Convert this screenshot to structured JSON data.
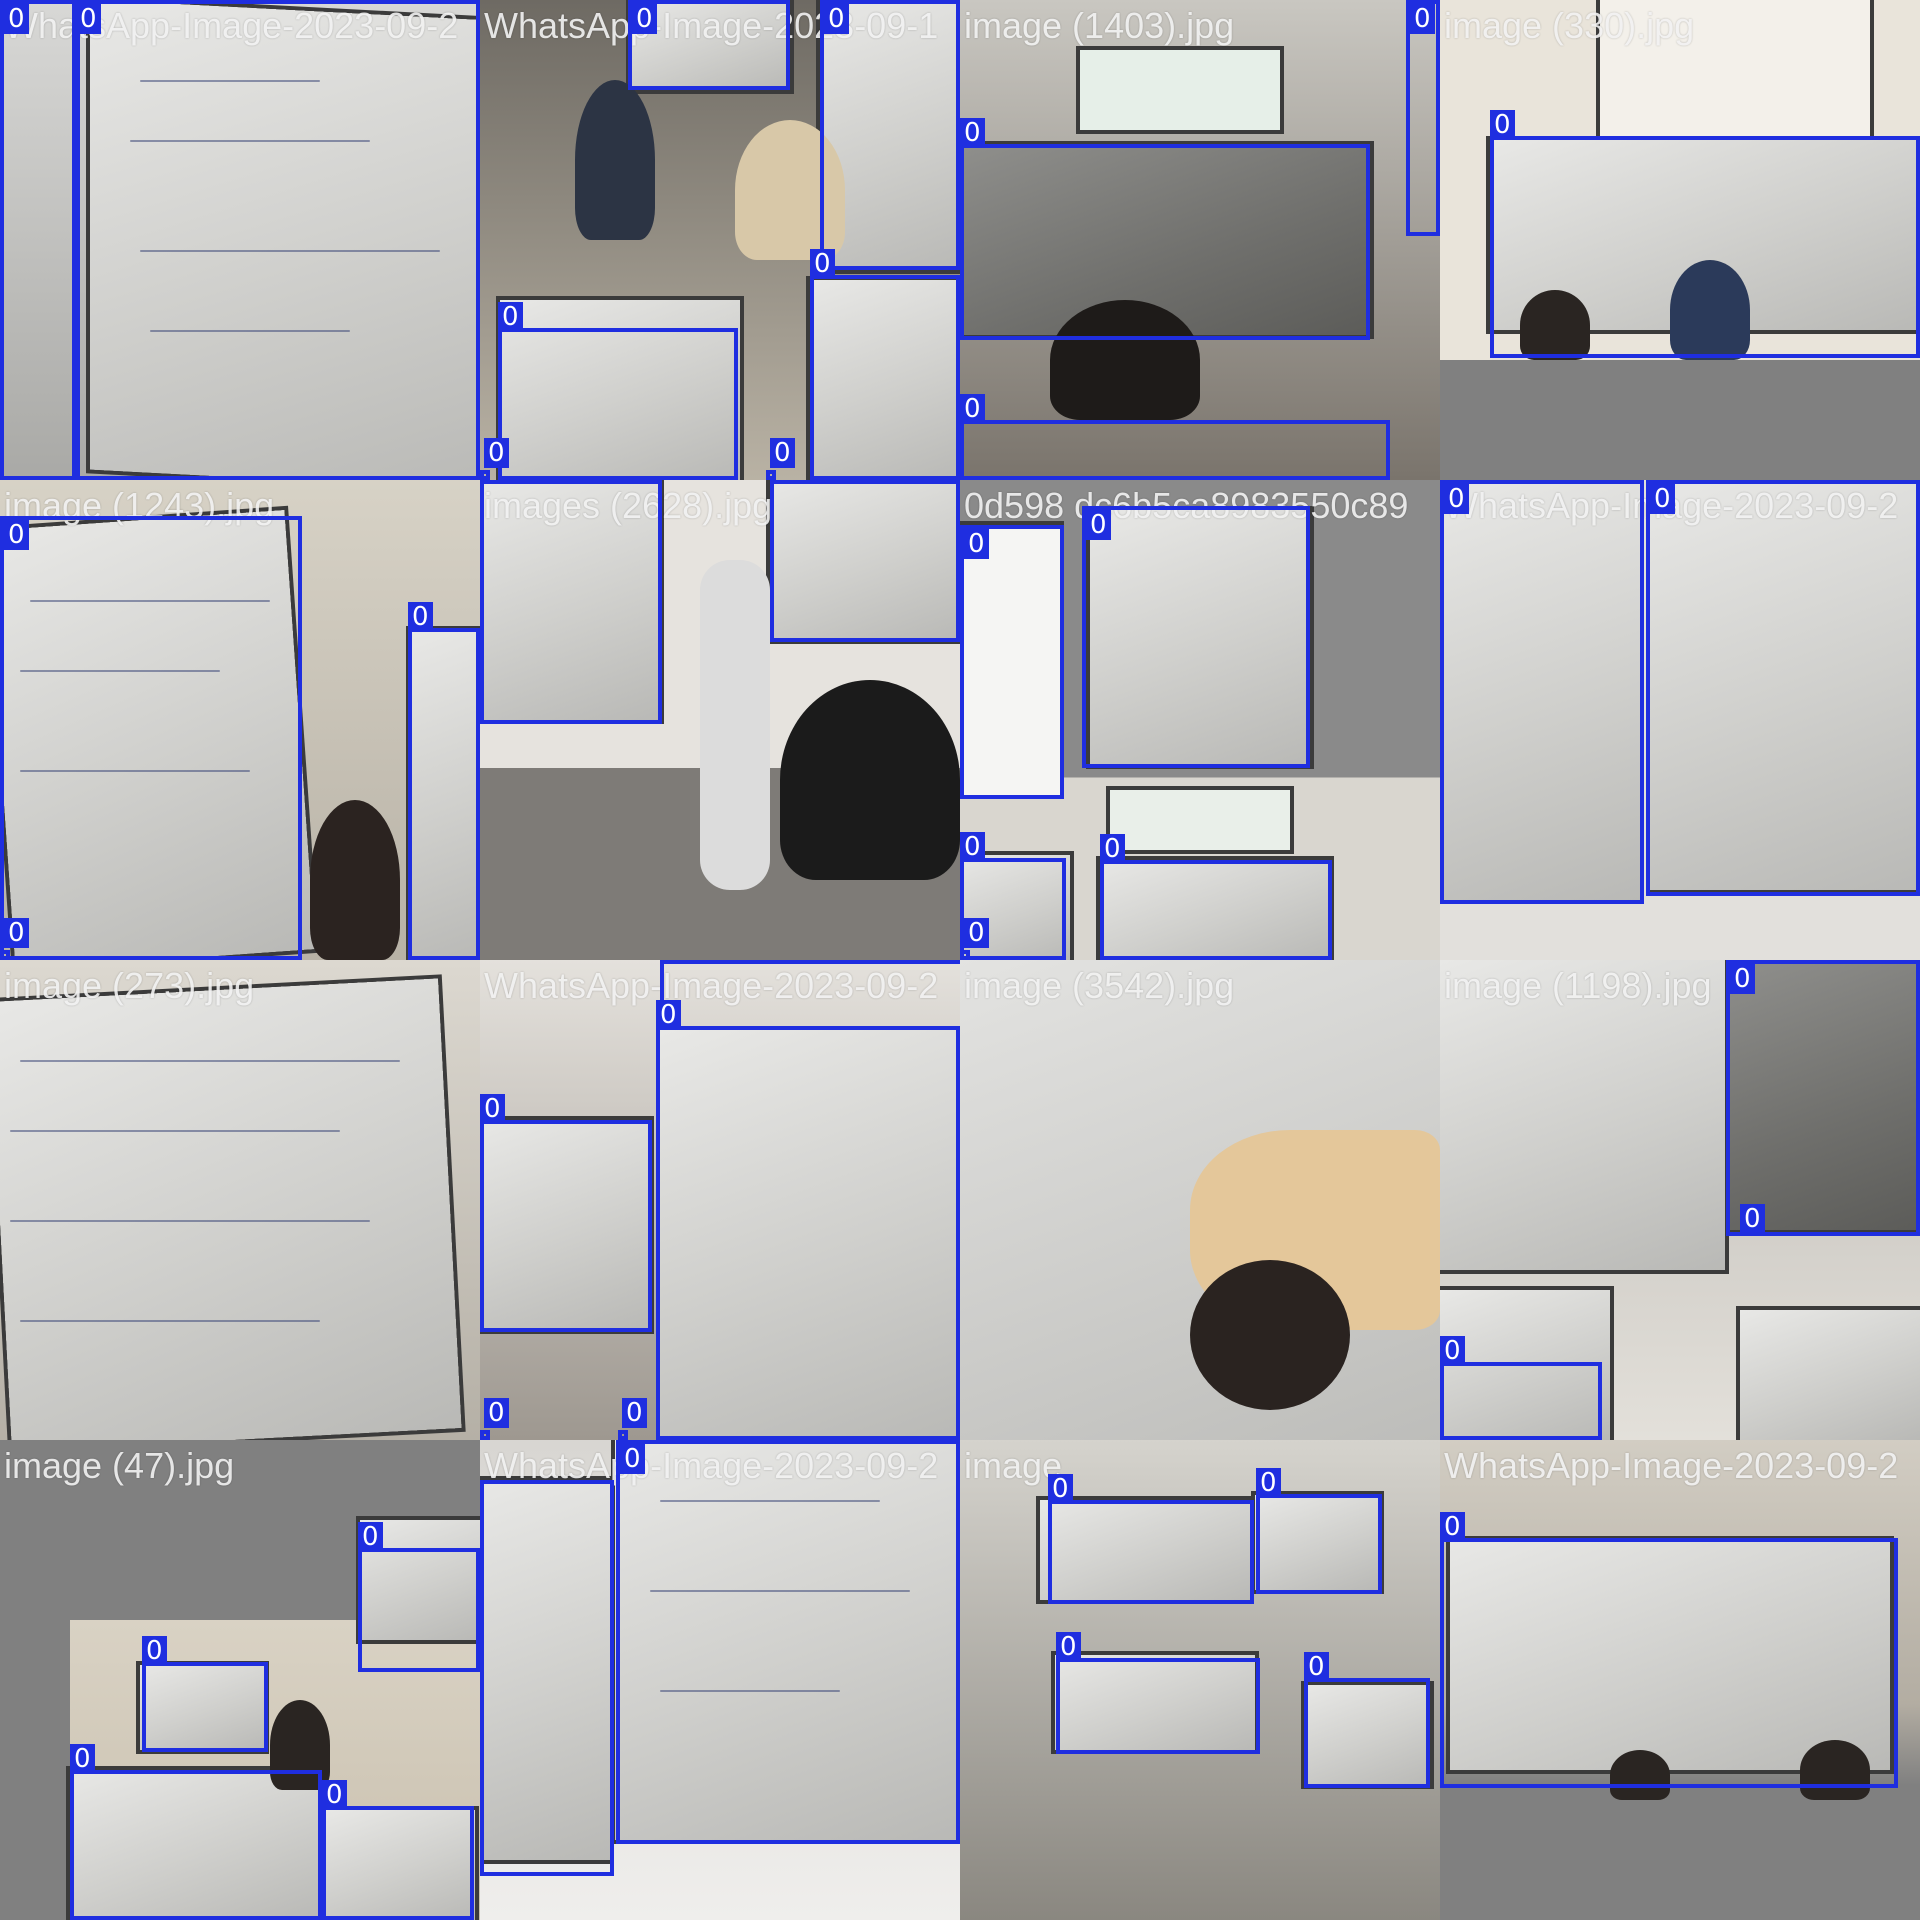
{
  "box_color": "#1f2ee0",
  "tiles": [
    {
      "caption": "WhatsApp-Image-2023-09-2",
      "boxes": [
        "0",
        "0"
      ]
    },
    {
      "caption": "WhatsApp-Image-2023-09-1",
      "boxes": [
        "0",
        "0",
        "0",
        "0",
        "0",
        "0"
      ]
    },
    {
      "caption": "image (1403).jpg",
      "boxes": [
        "0",
        "0",
        "0"
      ]
    },
    {
      "caption": "image (330).jpg",
      "boxes": [
        "0"
      ]
    },
    {
      "caption": "image (1243).jpg",
      "boxes": [
        "0",
        "0",
        "0"
      ]
    },
    {
      "caption": "images (2628).jpg",
      "boxes": []
    },
    {
      "caption": "0d598 dc6b5ca8983550c89",
      "boxes": [
        "0",
        "0",
        "0",
        "0",
        "0"
      ]
    },
    {
      "caption": "WhatsApp-Image-2023-09-2",
      "boxes": [
        "0",
        "0"
      ]
    },
    {
      "caption": "image (273).jpg",
      "boxes": []
    },
    {
      "caption": "WhatsApp-Image-2023-09-2",
      "boxes": [
        "0",
        "0",
        "0",
        "0",
        "0"
      ]
    },
    {
      "caption": "image (3542).jpg",
      "boxes": []
    },
    {
      "caption": "image (1198).jpg",
      "boxes": [
        "0",
        "0",
        "0"
      ]
    },
    {
      "caption": "image (47).jpg",
      "boxes": [
        "0",
        "0",
        "0",
        "0"
      ]
    },
    {
      "caption": "WhatsApp-Image-2023-09-2",
      "boxes": [
        "0"
      ]
    },
    {
      "caption": "image",
      "boxes": [
        "0",
        "0",
        "0",
        "0"
      ]
    },
    {
      "caption": "WhatsApp-Image-2023-09-2",
      "boxes": [
        "0"
      ]
    }
  ]
}
